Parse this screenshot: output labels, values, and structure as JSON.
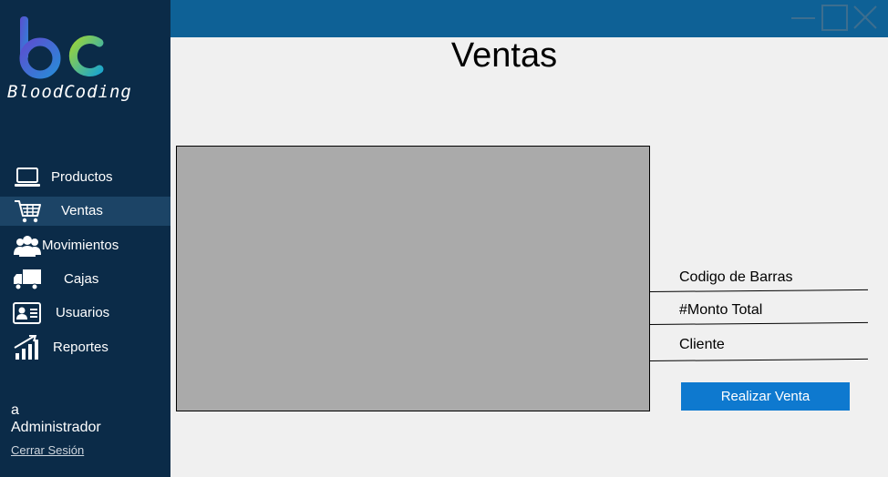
{
  "app": {
    "brand_name": "BloodCoding",
    "logo_icon": "bc-logo-icon"
  },
  "window": {
    "controls": [
      {
        "name": "minimize-button",
        "icon": "minimize-icon"
      },
      {
        "name": "maximize-button",
        "icon": "maximize-icon"
      },
      {
        "name": "close-button",
        "icon": "close-icon"
      }
    ]
  },
  "sidebar": {
    "items": [
      {
        "label": "Productos",
        "icon": "laptop-icon",
        "active": false
      },
      {
        "label": "Ventas",
        "icon": "shopping-cart-icon",
        "active": true
      },
      {
        "label": "Movimientos",
        "icon": "users-group-icon",
        "active": false
      },
      {
        "label": "Cajas",
        "icon": "delivery-truck-icon",
        "active": false
      },
      {
        "label": "Usuarios",
        "icon": "id-card-icon",
        "active": false
      },
      {
        "label": "Reportes",
        "icon": "bar-chart-up-icon",
        "active": false
      }
    ],
    "user": {
      "name": "a",
      "role": "Administrador",
      "logout_label": "Cerrar Sesión"
    }
  },
  "main": {
    "title": "Ventas",
    "fields": [
      {
        "label": "Codigo de Barras",
        "value": ""
      },
      {
        "label": "#Monto Total",
        "value": ""
      },
      {
        "label": "Cliente",
        "value": ""
      }
    ],
    "submit_label": "Realizar Venta"
  },
  "colors": {
    "sidebar_bg": "#0b2b48",
    "sidebar_active": "#1c4466",
    "titlebar_bg": "#0e6196",
    "content_bg": "#f0f0f0",
    "grid_bg": "#aaaaaa",
    "button_bg": "#0e79cf"
  }
}
